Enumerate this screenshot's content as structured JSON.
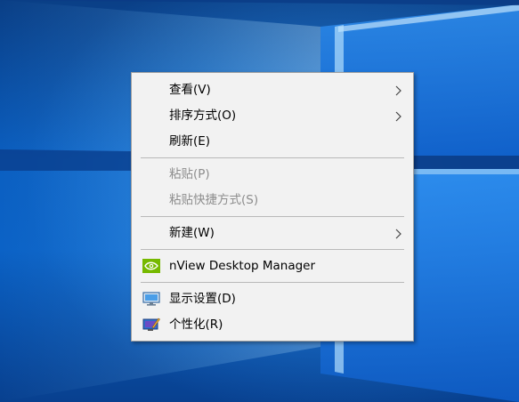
{
  "context_menu": {
    "items": [
      {
        "label": "查看(V)",
        "disabled": false,
        "submenu": true
      },
      {
        "label": "排序方式(O)",
        "disabled": false,
        "submenu": true
      },
      {
        "label": "刷新(E)",
        "disabled": false,
        "submenu": false
      },
      {
        "label": "粘贴(P)",
        "disabled": true,
        "submenu": false
      },
      {
        "label": "粘贴快捷方式(S)",
        "disabled": true,
        "submenu": false
      },
      {
        "label": "新建(W)",
        "disabled": false,
        "submenu": true
      },
      {
        "label": "nView Desktop Manager",
        "disabled": false,
        "submenu": false,
        "icon": "nvidia-icon"
      },
      {
        "label": "显示设置(D)",
        "disabled": false,
        "submenu": false,
        "icon": "display-settings-icon"
      },
      {
        "label": "个性化(R)",
        "disabled": false,
        "submenu": false,
        "icon": "personalize-icon"
      }
    ]
  },
  "colors": {
    "menu_background": "#f2f2f2",
    "disabled_text": "#8d8d8d",
    "desktop_blue": "#0b5fc1",
    "nvidia_green": "#76b900"
  }
}
